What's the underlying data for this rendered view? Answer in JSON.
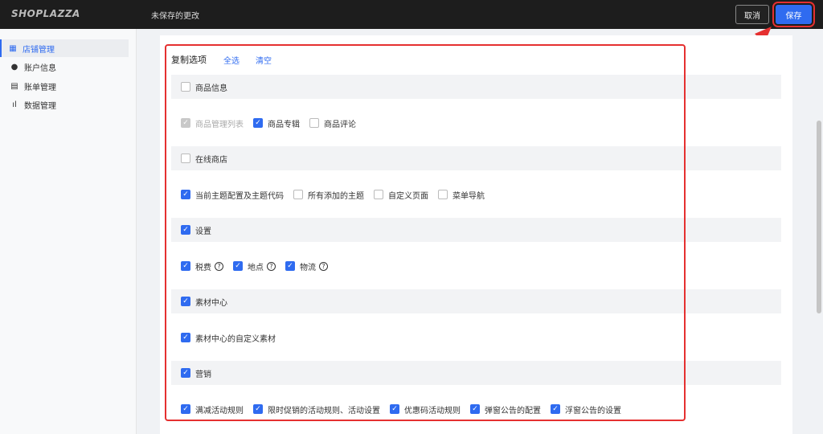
{
  "topbar": {
    "logo": "SHOPLAZZA",
    "unsaved": "未保存的更改",
    "cancel": "取消",
    "save": "保存"
  },
  "sidebar": {
    "items": [
      {
        "label": "店铺管理",
        "icon": "store-icon",
        "active": true
      },
      {
        "label": "账户信息",
        "icon": "user-icon"
      },
      {
        "label": "账单管理",
        "icon": "bill-icon"
      },
      {
        "label": "数据管理",
        "icon": "chart-icon"
      }
    ]
  },
  "main": {
    "title": "复制选项",
    "select_all": "全选",
    "clear": "清空",
    "sections": [
      {
        "label": "商品信息",
        "checked": false,
        "items": [
          {
            "label": "商品管理列表",
            "state": "disabled"
          },
          {
            "label": "商品专辑",
            "state": "on"
          },
          {
            "label": "商品评论",
            "state": "off"
          }
        ]
      },
      {
        "label": "在线商店",
        "checked": false,
        "items": [
          {
            "label": "当前主题配置及主题代码",
            "state": "on"
          },
          {
            "label": "所有添加的主题",
            "state": "off"
          },
          {
            "label": "自定义页面",
            "state": "off"
          },
          {
            "label": "菜单导航",
            "state": "off"
          }
        ]
      },
      {
        "label": "设置",
        "checked": true,
        "items": [
          {
            "label": "税费",
            "state": "on",
            "help": "?"
          },
          {
            "label": "地点",
            "state": "on",
            "help": "?"
          },
          {
            "label": "物流",
            "state": "on",
            "help": "?"
          }
        ]
      },
      {
        "label": "素材中心",
        "checked": true,
        "items": [
          {
            "label": "素材中心的自定义素材",
            "state": "on"
          }
        ]
      },
      {
        "label": "营销",
        "checked": true,
        "items": [
          {
            "label": "满减活动规则",
            "state": "on"
          },
          {
            "label": "限时促销的活动规则、活动设置",
            "state": "on"
          },
          {
            "label": "优惠码活动规则",
            "state": "on"
          },
          {
            "label": "弹窗公告的配置",
            "state": "on"
          },
          {
            "label": "浮窗公告的设置",
            "state": "on"
          }
        ]
      }
    ]
  }
}
